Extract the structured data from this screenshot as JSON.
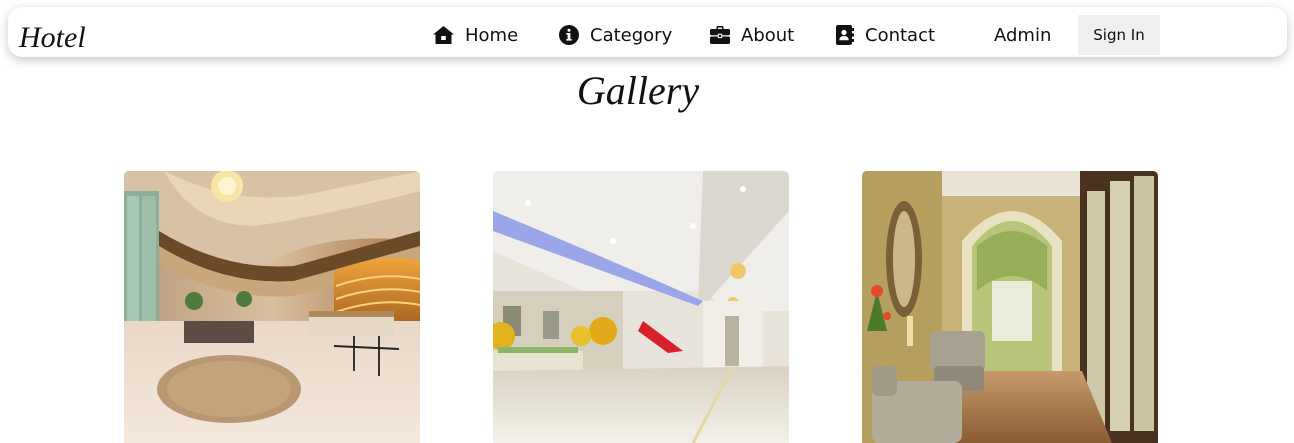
{
  "navbar": {
    "brand": "Hotel",
    "items": [
      {
        "label": "Home",
        "icon": "home-icon"
      },
      {
        "label": "Category",
        "icon": "info-circle-icon"
      },
      {
        "label": "About",
        "icon": "briefcase-icon"
      },
      {
        "label": "Contact",
        "icon": "contact-book-icon"
      }
    ],
    "admin": "Admin",
    "sign_in": "Sign In"
  },
  "page": {
    "title": "Gallery"
  },
  "gallery": {
    "images": [
      {
        "subject": "hotel-lobby-atrium-photo"
      },
      {
        "subject": "hotel-hallway-lobby-photo"
      },
      {
        "subject": "hotel-corridor-archway-photo"
      }
    ]
  },
  "colors": {
    "text": "#111111",
    "navbar_bg": "#ffffff",
    "signin_bg": "#efefef"
  }
}
